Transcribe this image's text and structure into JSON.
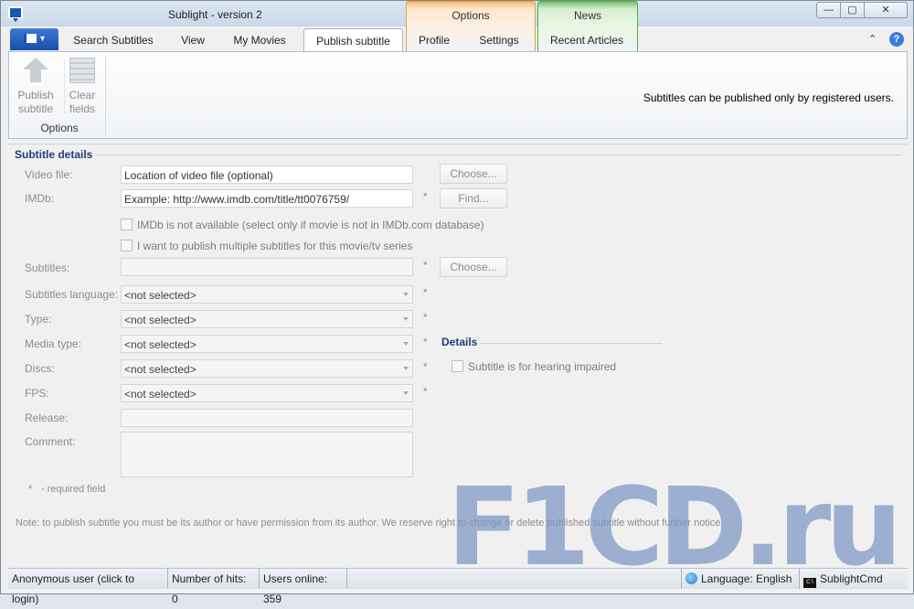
{
  "window": {
    "title": "Sublight - version 2",
    "buttons": {
      "minimize": "—",
      "maximize": "▢",
      "close": "✕"
    }
  },
  "ribbon": {
    "app_menu_icon": "app-menu-icon",
    "tabs": [
      {
        "label": "Search Subtitles"
      },
      {
        "label": "View"
      },
      {
        "label": "My Movies"
      },
      {
        "label": "Publish subtitle",
        "active": true
      },
      {
        "label": "Profile"
      },
      {
        "label": "Settings"
      },
      {
        "label": "Recent Articles"
      }
    ],
    "context_groups": {
      "options": "Options",
      "news": "News"
    },
    "collapse_glyph": "⌃",
    "help_glyph": "?",
    "buttons": [
      {
        "label": "Publish subtitle",
        "icon": "upload-arrow-icon"
      },
      {
        "label": "Clear fields",
        "icon": "clear-fields-icon"
      }
    ],
    "group_label": "Options",
    "note": "Subtitles can be published only by registered users."
  },
  "form": {
    "section_title": "Subtitle details",
    "video_file": {
      "label": "Video file:",
      "placeholder": "Location of video file (optional)",
      "button": "Choose..."
    },
    "imdb": {
      "label": "IMDb:",
      "placeholder": "Example: http://www.imdb.com/title/tt0076759/",
      "button": "Find...",
      "required": "*"
    },
    "checkboxes": [
      "IMDb is not available (select only if movie is not in IMDb.com database)",
      "I want to publish multiple subtitles for this movie/tv series"
    ],
    "subtitles": {
      "label": "Subtitles:",
      "button": "Choose...",
      "required": "*"
    },
    "selects": [
      {
        "label": "Subtitles language:",
        "value": "<not selected>",
        "required": "*"
      },
      {
        "label": "Type:",
        "value": "<not selected>",
        "required": "*"
      },
      {
        "label": "Media type:",
        "value": "<not selected>",
        "required": "*"
      },
      {
        "label": "Discs:",
        "value": "<not selected>",
        "required": "*"
      },
      {
        "label": "FPS:",
        "value": "<not selected>",
        "required": "*"
      }
    ],
    "release": {
      "label": "Release:"
    },
    "comment": {
      "label": "Comment:"
    },
    "required_hint": {
      "star": "*",
      "text": "- required field"
    },
    "note": "Note: to publish subtitle you must be its author or have permission from its author. We reserve right to change or delete published subtitle without further notice.",
    "details": {
      "title": "Details",
      "checkbox": "Subtitle is for hearing impaired"
    }
  },
  "status": {
    "user": "Anonymous user (click to login)",
    "hits": "Number of hits: 0",
    "online": "Users online: 359",
    "language": "Language: English",
    "cmd": "SublightCmd",
    "cmd_icon_text": "C:\\"
  },
  "watermark": "F1CD.ru"
}
